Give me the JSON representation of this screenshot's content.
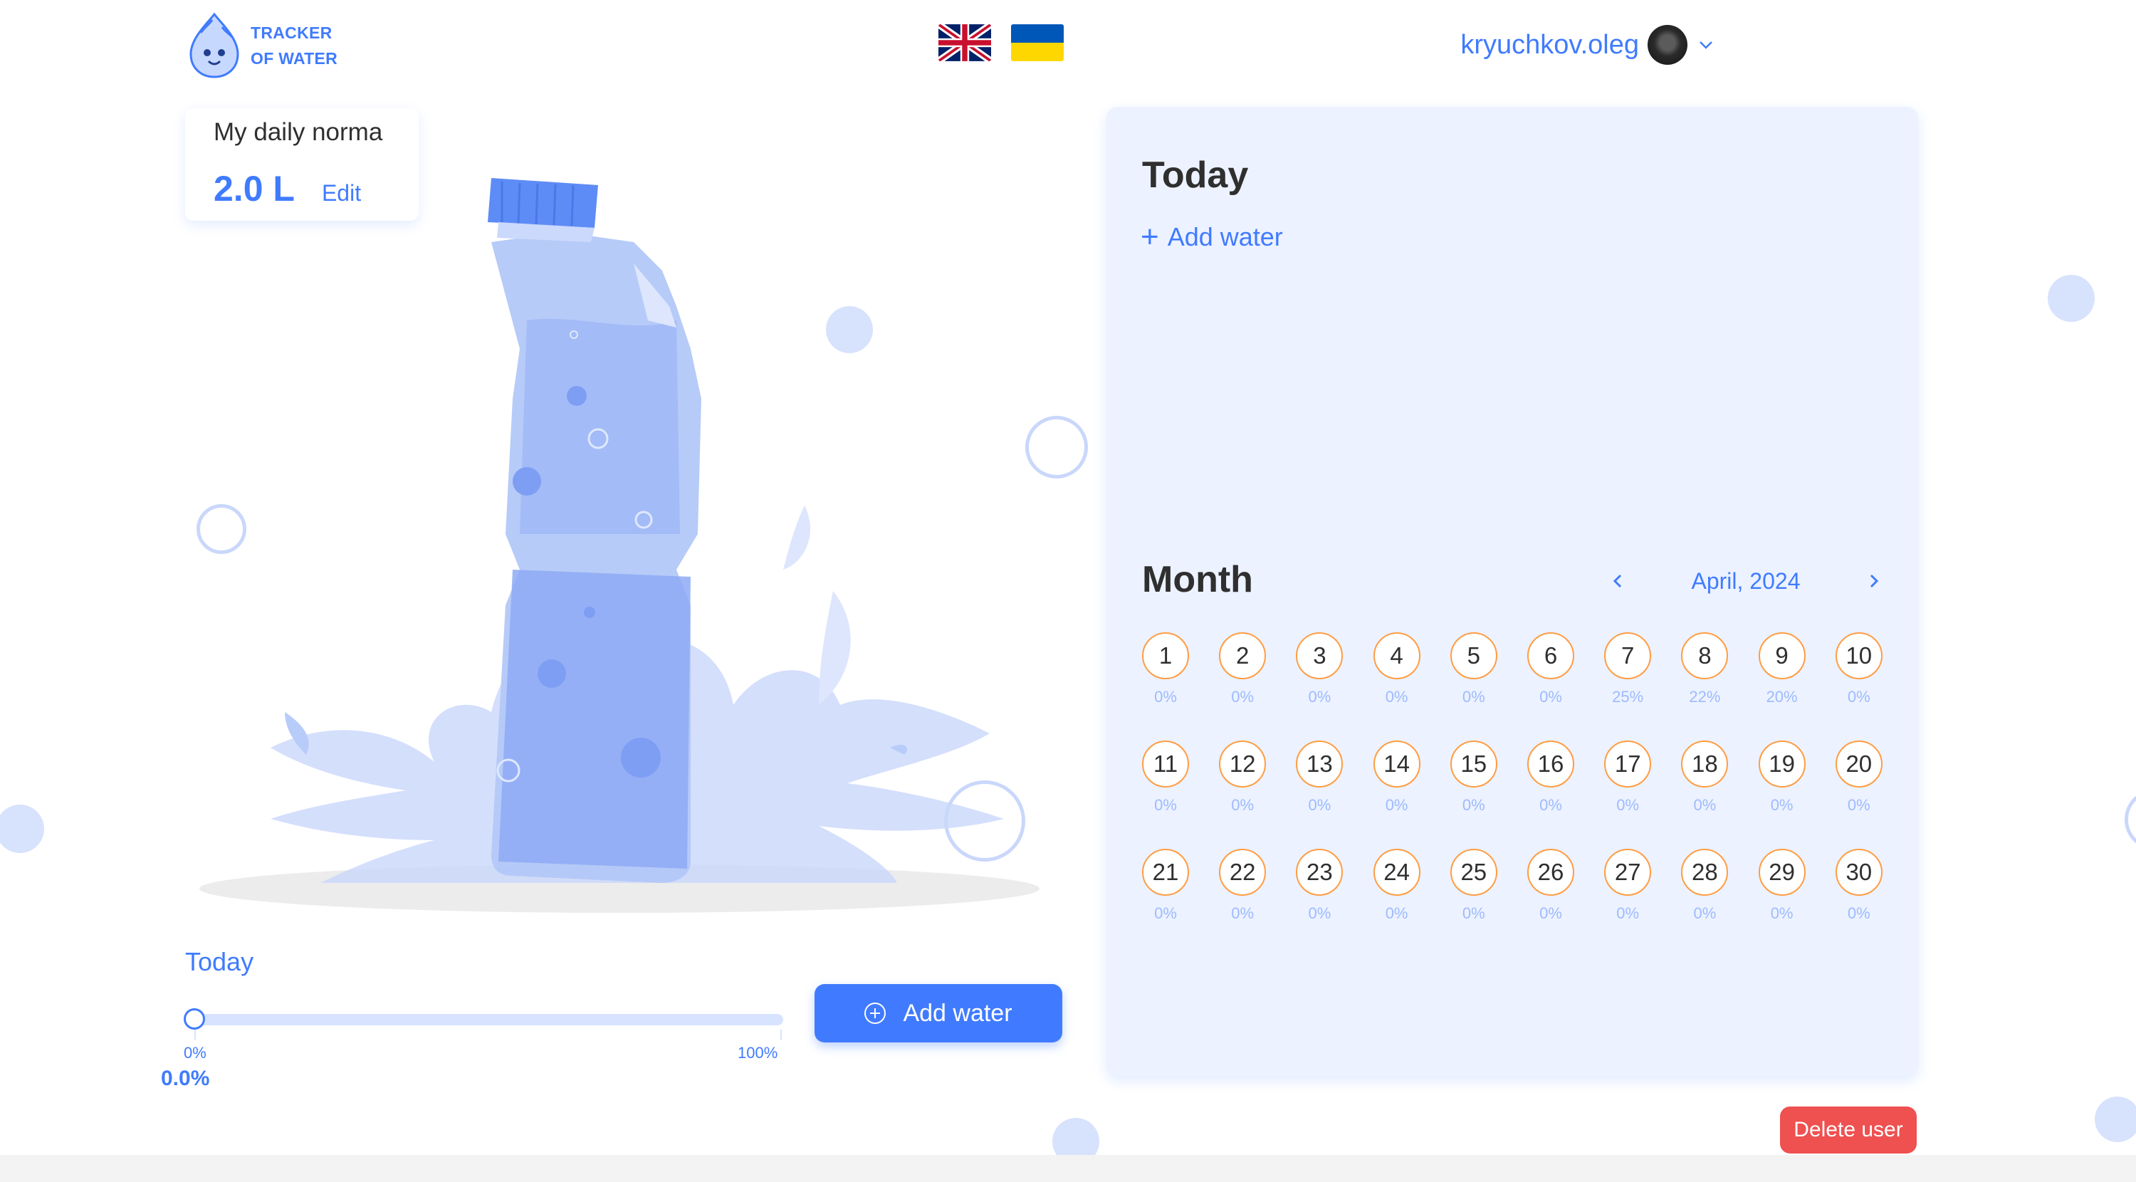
{
  "header": {
    "logo_line1": "TRACKER",
    "logo_line2": "OF WATER",
    "languages": [
      "english-flag",
      "ukrainian-flag"
    ],
    "user_name": "kryuchkov.oleg"
  },
  "daily_norma": {
    "title": "My daily norma",
    "value": "2.0 L",
    "edit_label": "Edit"
  },
  "today_progress": {
    "label": "Today",
    "min_label": "0%",
    "max_label": "100%",
    "value_text": "0.0%",
    "fraction": 0.0,
    "add_button": "Add water"
  },
  "today_panel": {
    "title": "Today",
    "add_water": "Add water"
  },
  "month_panel": {
    "title": "Month",
    "month_label": "April, 2024",
    "days": [
      {
        "day": "1",
        "pct": "0%"
      },
      {
        "day": "2",
        "pct": "0%"
      },
      {
        "day": "3",
        "pct": "0%"
      },
      {
        "day": "4",
        "pct": "0%"
      },
      {
        "day": "5",
        "pct": "0%"
      },
      {
        "day": "6",
        "pct": "0%"
      },
      {
        "day": "7",
        "pct": "25%"
      },
      {
        "day": "8",
        "pct": "22%"
      },
      {
        "day": "9",
        "pct": "20%"
      },
      {
        "day": "10",
        "pct": "0%"
      },
      {
        "day": "11",
        "pct": "0%"
      },
      {
        "day": "12",
        "pct": "0%"
      },
      {
        "day": "13",
        "pct": "0%"
      },
      {
        "day": "14",
        "pct": "0%"
      },
      {
        "day": "15",
        "pct": "0%"
      },
      {
        "day": "16",
        "pct": "0%"
      },
      {
        "day": "17",
        "pct": "0%"
      },
      {
        "day": "18",
        "pct": "0%"
      },
      {
        "day": "19",
        "pct": "0%"
      },
      {
        "day": "20",
        "pct": "0%"
      },
      {
        "day": "21",
        "pct": "0%"
      },
      {
        "day": "22",
        "pct": "0%"
      },
      {
        "day": "23",
        "pct": "0%"
      },
      {
        "day": "24",
        "pct": "0%"
      },
      {
        "day": "25",
        "pct": "0%"
      },
      {
        "day": "26",
        "pct": "0%"
      },
      {
        "day": "27",
        "pct": "0%"
      },
      {
        "day": "28",
        "pct": "0%"
      },
      {
        "day": "29",
        "pct": "0%"
      },
      {
        "day": "30",
        "pct": "0%"
      }
    ]
  },
  "delete_user": "Delete user",
  "colors": {
    "accent": "#407bff",
    "panel_bg": "#ecf2ff",
    "day_border": "#ff9d43",
    "danger": "#ef5050"
  }
}
